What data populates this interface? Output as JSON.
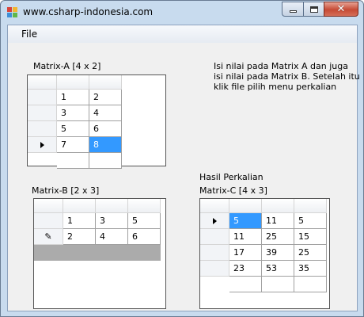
{
  "window": {
    "title": "www.csharp-indonesia.com",
    "controls": {
      "minimize": "minimize",
      "maximize": "maximize",
      "close": "✕"
    }
  },
  "menu": {
    "file": "File"
  },
  "info_text": "Isi nilai pada Matrix A dan juga isi nilai pada Matrix B. Setelah itu klik file pilih menu perkalian",
  "matrix_a": {
    "label": "Matrix-A [4 x 2]",
    "rows": [
      [
        "1",
        "2"
      ],
      [
        "3",
        "4"
      ],
      [
        "5",
        "6"
      ],
      [
        "7",
        "8"
      ]
    ],
    "current_row": 3,
    "selected_cell": [
      3,
      1
    ]
  },
  "matrix_b": {
    "label": "Matrix-B [2 x 3]",
    "rows": [
      [
        "1",
        "3",
        "5"
      ],
      [
        "2",
        "4",
        "6"
      ]
    ],
    "editing_row": 1
  },
  "matrix_c": {
    "title": "Hasil Perkalian",
    "label": "Matrix-C [4 x 3]",
    "rows": [
      [
        "5",
        "11",
        "5"
      ],
      [
        "11",
        "25",
        "15"
      ],
      [
        "17",
        "39",
        "25"
      ],
      [
        "23",
        "53",
        "35"
      ]
    ],
    "current_row": 0,
    "selected_cell": [
      0,
      0
    ]
  },
  "colors": {
    "selection": "#3399ff",
    "window_frame": "#c8dbee",
    "client_bg": "#f0f0f0"
  }
}
